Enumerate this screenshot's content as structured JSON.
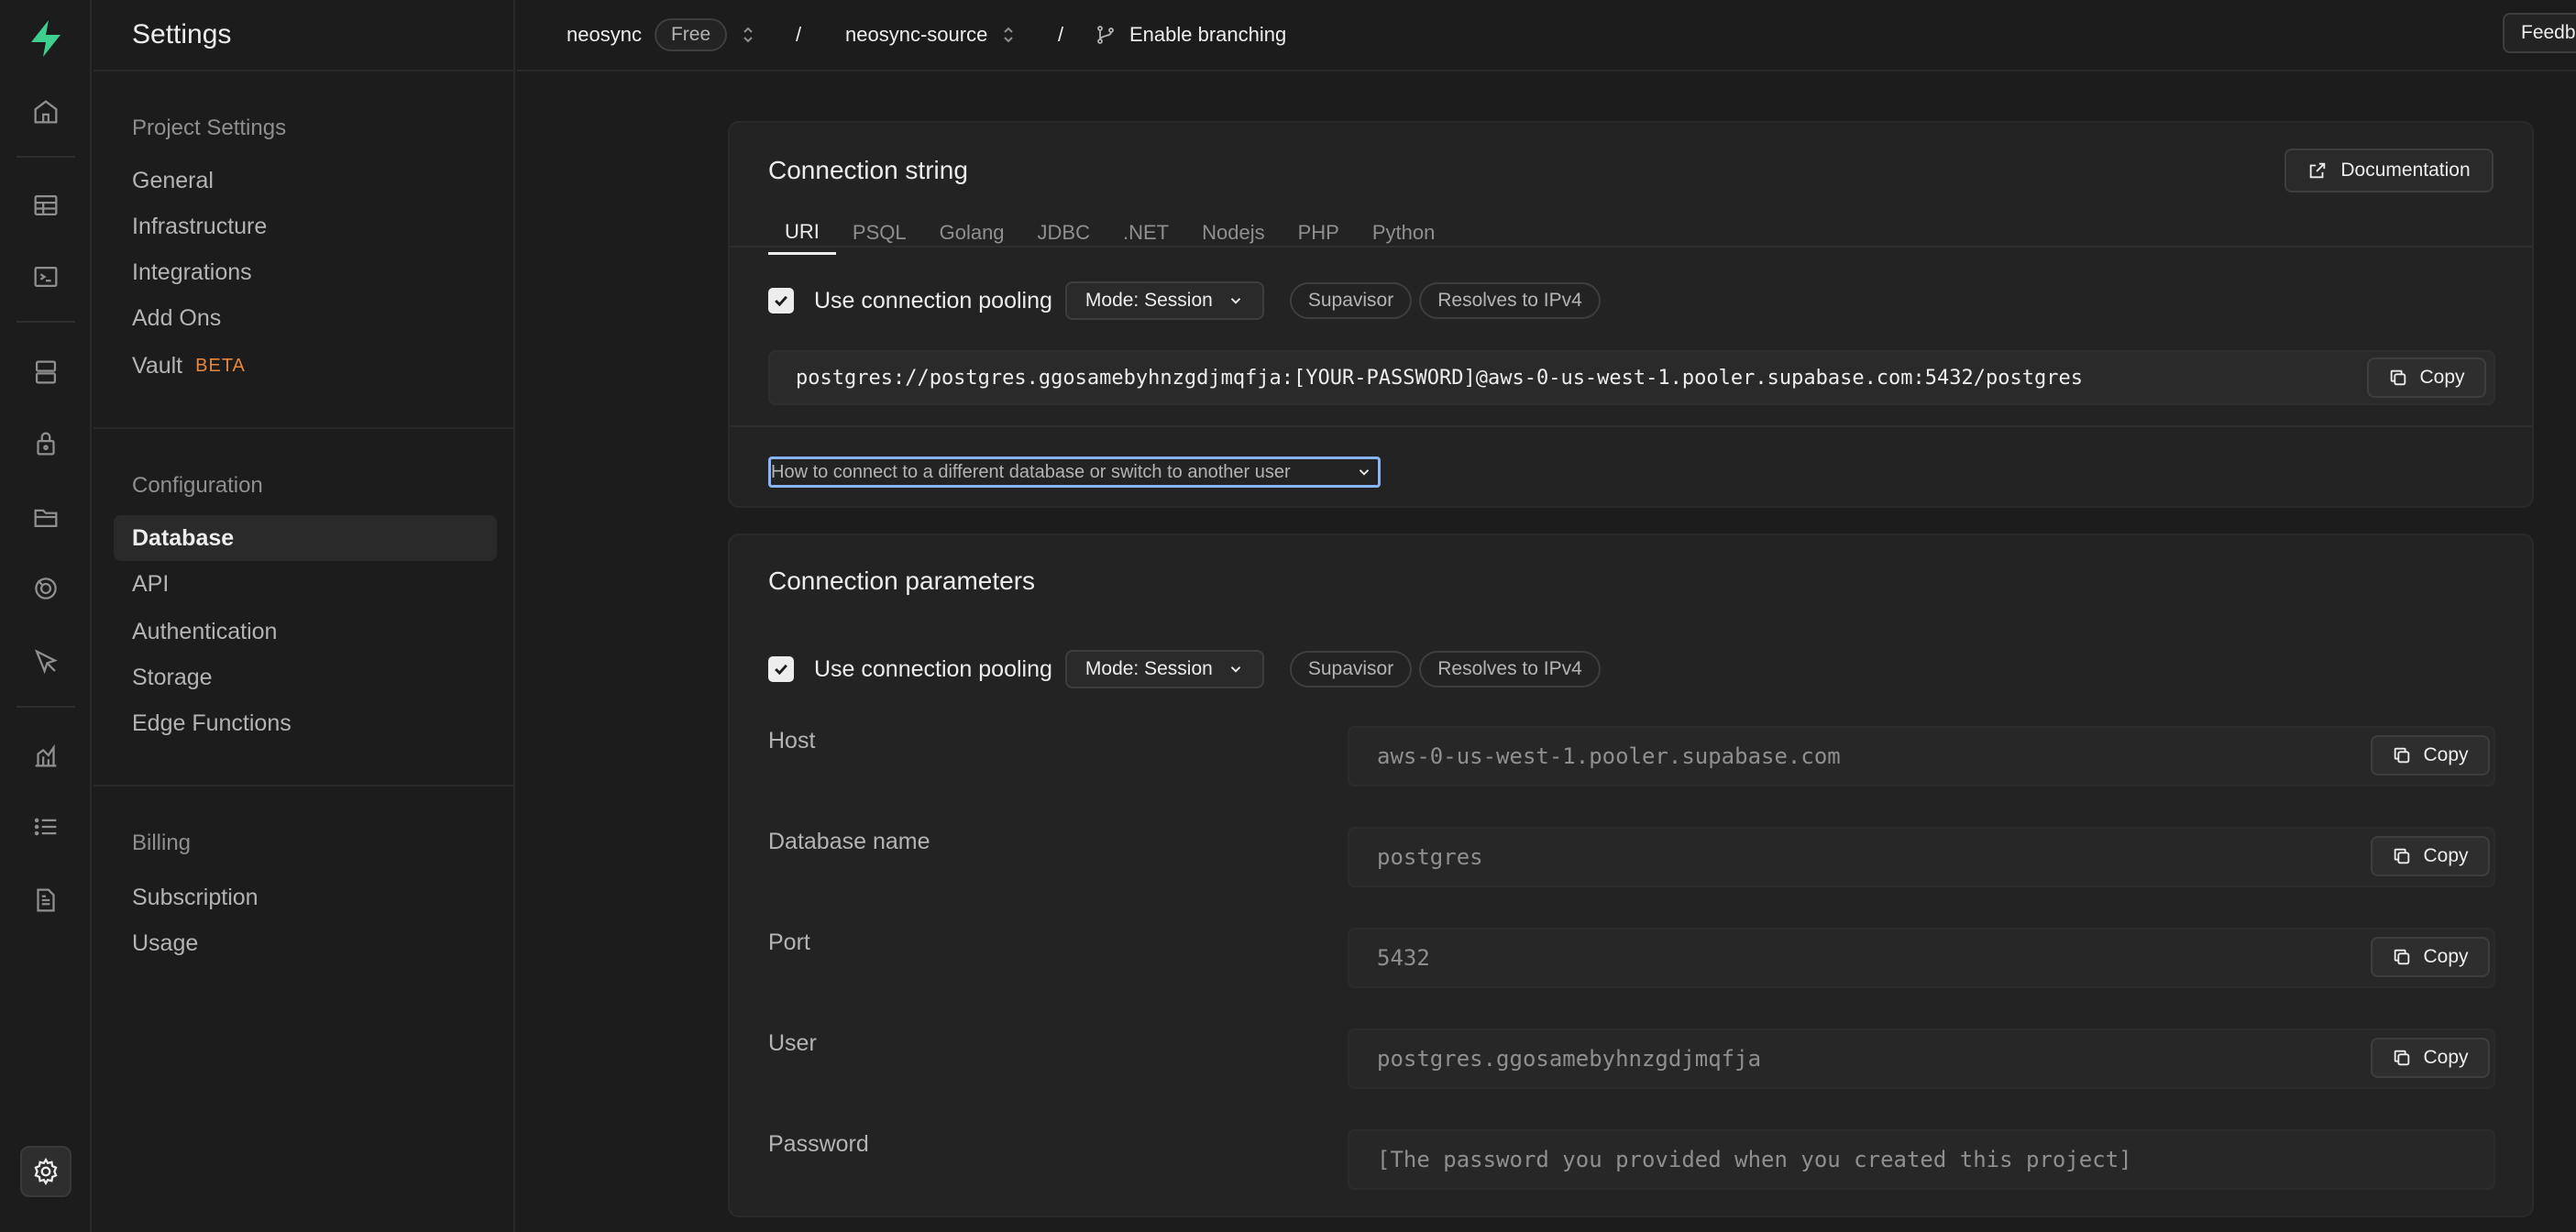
{
  "header": {
    "settings_title": "Settings",
    "org": "neosync",
    "plan": "Free",
    "project": "neosync-source",
    "branching": "Enable branching",
    "feedback": "Feedb"
  },
  "sidebar": {
    "sections": [
      {
        "heading": "Project Settings",
        "items": [
          {
            "label": "General"
          },
          {
            "label": "Infrastructure"
          },
          {
            "label": "Integrations"
          },
          {
            "label": "Add Ons"
          },
          {
            "label": "Vault",
            "badge": "BETA"
          }
        ]
      },
      {
        "heading": "Configuration",
        "items": [
          {
            "label": "Database",
            "active": true
          },
          {
            "label": "API"
          },
          {
            "label": "Authentication"
          },
          {
            "label": "Storage"
          },
          {
            "label": "Edge Functions"
          }
        ]
      },
      {
        "heading": "Billing",
        "items": [
          {
            "label": "Subscription"
          },
          {
            "label": "Usage"
          }
        ]
      }
    ]
  },
  "rail": {
    "icons": [
      "home-icon",
      "table-editor-icon",
      "sql-editor-icon",
      "database-icon",
      "auth-icon",
      "storage-icon",
      "realtime-icon",
      "edge-functions-icon",
      "reports-icon",
      "logs-icon",
      "docs-icon",
      "settings-icon"
    ]
  },
  "connection_string": {
    "title": "Connection string",
    "documentation": "Documentation",
    "tabs": [
      "URI",
      "PSQL",
      "Golang",
      "JDBC",
      ".NET",
      "Nodejs",
      "PHP",
      "Python"
    ],
    "active_tab": "URI",
    "pooling_label": "Use connection pooling",
    "pooling_checked": true,
    "mode": "Mode: Session",
    "badges": [
      "Supavisor",
      "Resolves to IPv4"
    ],
    "uri": "postgres://postgres.ggosamebyhnzgdjmqfja:[YOUR-PASSWORD]@aws-0-us-west-1.pooler.supabase.com:5432/postgres",
    "copy": "Copy",
    "howto": "How to connect to a different database or switch to another user"
  },
  "connection_params": {
    "title": "Connection parameters",
    "pooling_label": "Use connection pooling",
    "mode": "Mode: Session",
    "badges": [
      "Supavisor",
      "Resolves to IPv4"
    ],
    "copy": "Copy",
    "params": [
      {
        "label": "Host",
        "value": "aws-0-us-west-1.pooler.supabase.com"
      },
      {
        "label": "Database name",
        "value": "postgres"
      },
      {
        "label": "Port",
        "value": "5432"
      },
      {
        "label": "User",
        "value": "postgres.ggosamebyhnzgdjmqfja"
      },
      {
        "label": "Password",
        "value": "[The password you provided when you created this project]"
      }
    ]
  }
}
